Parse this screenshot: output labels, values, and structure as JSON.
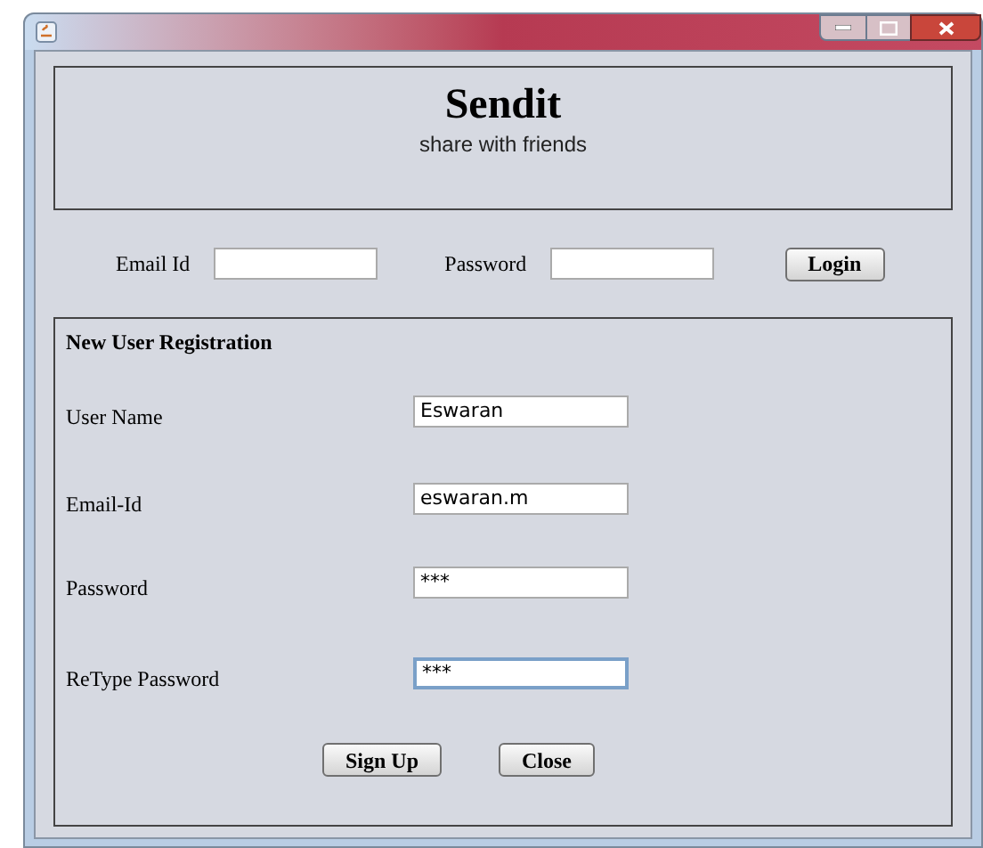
{
  "header": {
    "title": "Sendit",
    "subtitle": "share with friends"
  },
  "login": {
    "email_label": "Email Id",
    "password_label": "Password",
    "button": "Login"
  },
  "registration": {
    "title": "New User Registration",
    "fields": [
      {
        "label": "User Name",
        "value": "Eswaran",
        "focused": false
      },
      {
        "label": "Email-Id",
        "value": "eswaran.m",
        "focused": false
      },
      {
        "label": "Password",
        "value": "***",
        "focused": false
      },
      {
        "label": "ReType Password",
        "value": "***",
        "focused": true
      }
    ],
    "buttons": [
      "Sign Up",
      "Close"
    ]
  }
}
